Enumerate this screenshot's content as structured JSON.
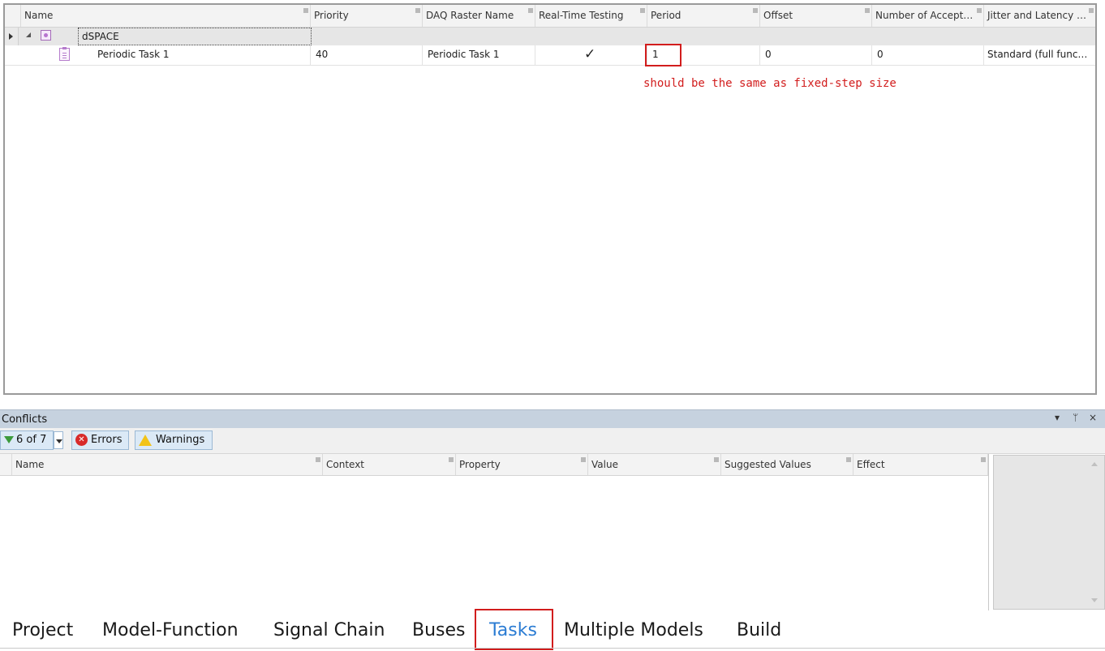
{
  "tasks_grid": {
    "columns": [
      "Name",
      "Priority",
      "DAQ Raster Name",
      "Real-Time Testing",
      "Period",
      "Offset",
      "Number of Accept…",
      "Jitter and Latency …"
    ],
    "group_row": {
      "name": "dSPACE"
    },
    "task_row": {
      "name": "Periodic Task 1",
      "priority": "40",
      "daq_raster_name": "Periodic Task 1",
      "real_time_testing": "✓",
      "period": "1",
      "offset": "0",
      "number_of_accepted": "0",
      "jitter_and_latency": "Standard (full func…"
    },
    "annotation": "should be the same as fixed-step size",
    "colors": {
      "annotation": "#d21d1d",
      "highlight_box": "#d21d1d"
    }
  },
  "conflicts": {
    "title": "Conflicts",
    "pane_controls": {
      "dropdown": "▾",
      "pin": "ᛘ",
      "close": "×"
    },
    "filter_label": "6 of 7",
    "errors_label": "Errors",
    "warnings_label": "Warnings",
    "error_glyph": "✕",
    "columns": [
      "Name",
      "Context",
      "Property",
      "Value",
      "Suggested Values",
      "Effect"
    ]
  },
  "bottom_tabs": {
    "items": [
      "Project",
      "Model-Function",
      "Signal Chain",
      "Buses",
      "Tasks",
      "Multiple Models",
      "Build"
    ],
    "active": "Tasks",
    "colors": {
      "active": "#2b7cd3",
      "highlight_box": "#d21d1d"
    }
  }
}
